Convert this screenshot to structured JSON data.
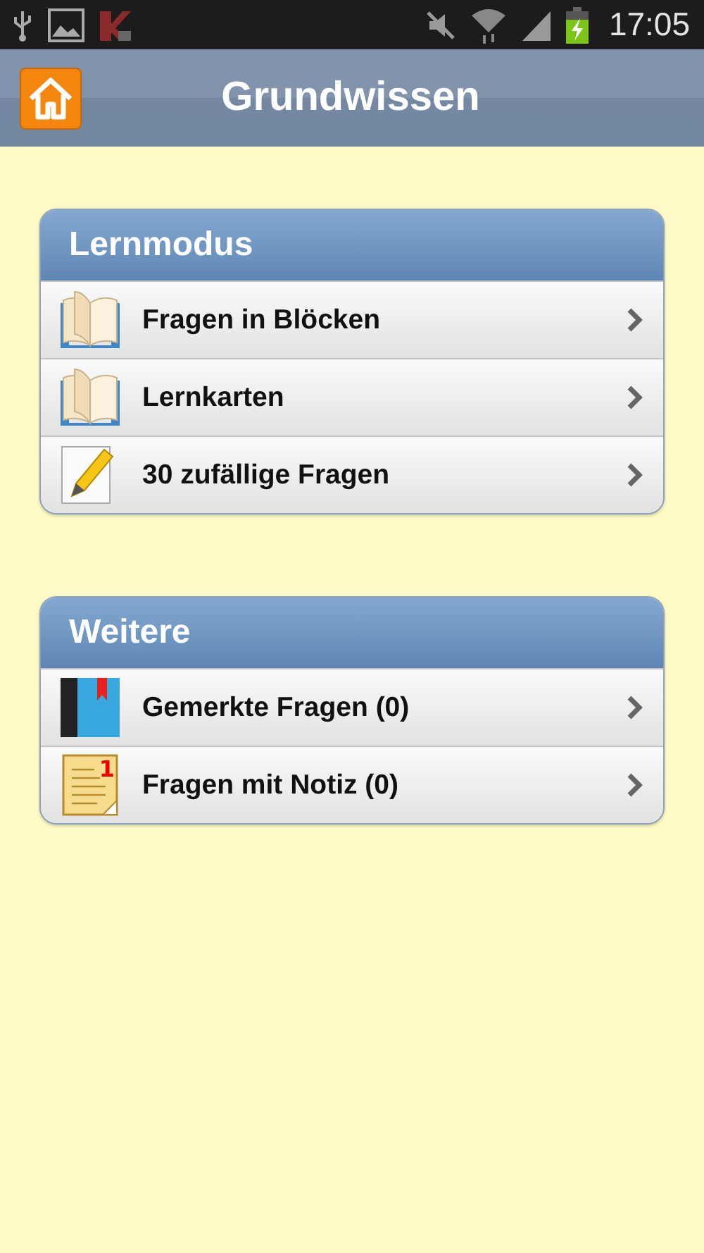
{
  "status_bar": {
    "time": "17:05"
  },
  "header": {
    "title": "Grundwissen"
  },
  "sections": [
    {
      "title": "Lernmodus",
      "items": [
        {
          "label": "Fragen in Blöcken",
          "kind": "book"
        },
        {
          "label": "Lernkarten",
          "kind": "book"
        },
        {
          "label": "30 zufällige Fragen",
          "kind": "pencil"
        }
      ]
    },
    {
      "title": "Weitere",
      "items": [
        {
          "label": "Gemerkte Fragen (0)",
          "kind": "bookmark"
        },
        {
          "label": "Fragen mit Notiz (0)",
          "kind": "note",
          "icon_text": "1"
        }
      ]
    }
  ]
}
